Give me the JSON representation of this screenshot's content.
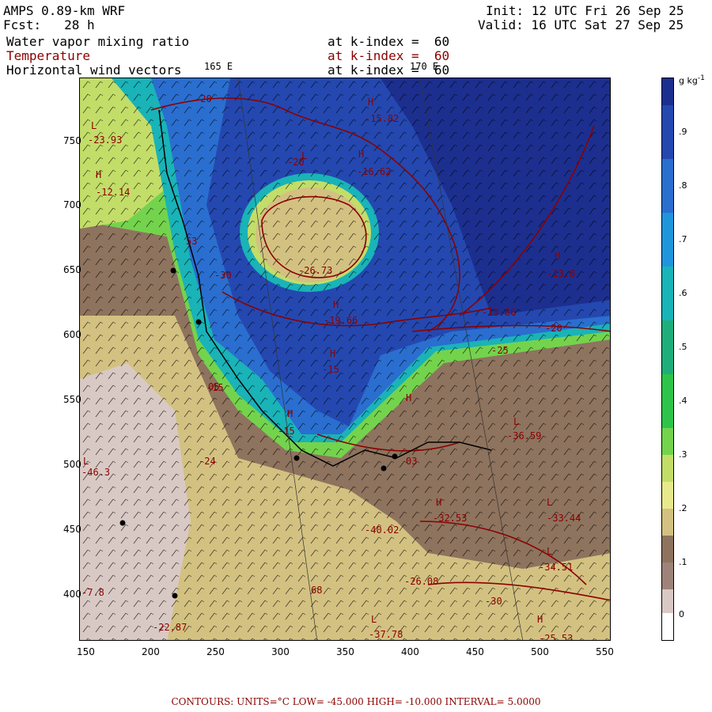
{
  "header": {
    "model": "AMPS 0.89-km WRF",
    "forecast": "Fcst:   28 h",
    "init": "Init: 12 UTC Fri 26 Sep 25",
    "valid": "Valid: 16 UTC Sat 27 Sep 25",
    "field1": "Water vapor mixing ratio",
    "field2": "Temperature",
    "field3": "Horizontal wind vectors",
    "level1": "at k-index =  60",
    "level2": "at k-index =  60",
    "level3": "at k-index =  60",
    "lon1": "165 E",
    "lon2": "170 E"
  },
  "colorbar": {
    "units": "g kg",
    "units_sup": "-1",
    "levels": [
      ".9",
      ".8",
      ".7",
      ".6",
      ".5",
      ".4",
      ".3",
      ".2",
      ".1",
      "0"
    ],
    "colors": [
      "#1c2f8f",
      "#2448b0",
      "#2a6ed0",
      "#1f95db",
      "#19b3b8",
      "#1fae7a",
      "#2ec44a",
      "#74d34d",
      "#c3dd69",
      "#e7e98c",
      "#d3c181",
      "#8e735e",
      "#9e8379",
      "#d9c9c4",
      "#ffffff"
    ]
  },
  "x_axis": [
    "150",
    "200",
    "250",
    "300",
    "350",
    "400",
    "450",
    "500",
    "550"
  ],
  "y_axis": [
    "750",
    "700",
    "650",
    "600",
    "550",
    "500",
    "450",
    "400"
  ],
  "contour_labels": [
    "-20",
    "-15.82",
    "-20",
    "-16.62",
    "-23.93",
    "-12.14",
    "-26.73",
    "-30",
    "-19.66",
    "-15",
    "-13.8",
    "-13.86",
    "-20",
    "-25",
    "-15",
    "-36.59",
    "-24",
    "-15",
    "-46.3",
    "-32.53",
    "-33.44",
    "-34.51",
    "-40.02",
    "-26.08",
    "-30",
    "-7.8",
    "-22.87",
    "-37.78",
    "-25.53",
    "53",
    "05",
    "03",
    "68"
  ],
  "highlow_marks": [
    "H",
    "H",
    "L",
    "H",
    "H",
    "H",
    "H",
    "L",
    "H",
    "L",
    "L",
    "H",
    "L",
    "H",
    "L",
    "L",
    "H"
  ],
  "footer": "CONTOURS:  UNITS=°C  LOW= -45.000     HIGH= -10.000     INTERVAL=   5.0000"
}
